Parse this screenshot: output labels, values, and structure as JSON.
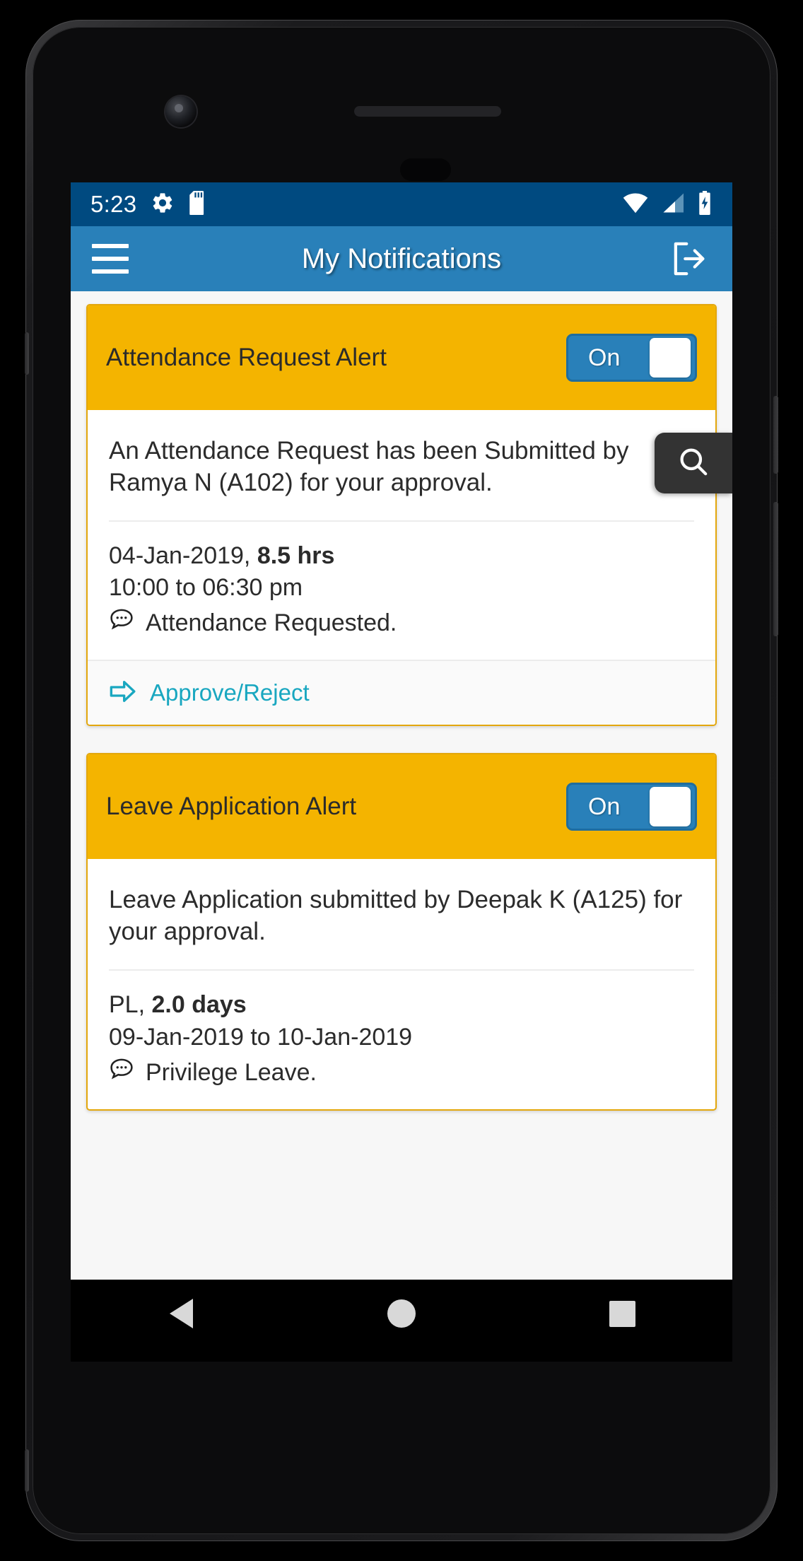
{
  "status_bar": {
    "time": "5:23",
    "icons": [
      "gear-icon",
      "sd-card-icon"
    ],
    "right_icons": [
      "wifi-icon",
      "cell-signal-icon",
      "battery-charging-icon"
    ],
    "background_color": "#004a80"
  },
  "app_bar": {
    "menu_icon": "hamburger-menu-icon",
    "title": "My Notifications",
    "logout_icon": "logout-icon",
    "background_color": "#2980b9"
  },
  "floating_search": {
    "icon": "search-icon",
    "background_color": "#333333"
  },
  "cards": [
    {
      "title": "Attendance Request Alert",
      "toggle_label": "On",
      "toggle_state": "on",
      "message": "An Attendance Request has been Submitted by Ramya N (A102) for your approval.",
      "detail_primary_prefix": "04-Jan-2019, ",
      "detail_primary_bold": "8.5 hrs",
      "detail_secondary": "10:00 to 06:30 pm",
      "comment_icon": "comment-bubble-icon",
      "comment_text": "Attendance Requested.",
      "action_icon": "arrow-right-icon",
      "action_label": "Approve/Reject",
      "header_color": "#f4b400",
      "accent_color": "#19a7c0"
    },
    {
      "title": "Leave Application Alert",
      "toggle_label": "On",
      "toggle_state": "on",
      "message": "Leave Application submitted by Deepak K (A125) for your approval.",
      "detail_primary_prefix": "PL, ",
      "detail_primary_bold": "2.0 days",
      "detail_secondary": "09-Jan-2019 to 10-Jan-2019",
      "comment_icon": "comment-bubble-icon",
      "comment_text": "Privilege Leave.",
      "header_color": "#f4b400"
    }
  ],
  "nav_bar": {
    "back_label": "back-button",
    "home_label": "home-button",
    "recents_label": "recents-button"
  }
}
